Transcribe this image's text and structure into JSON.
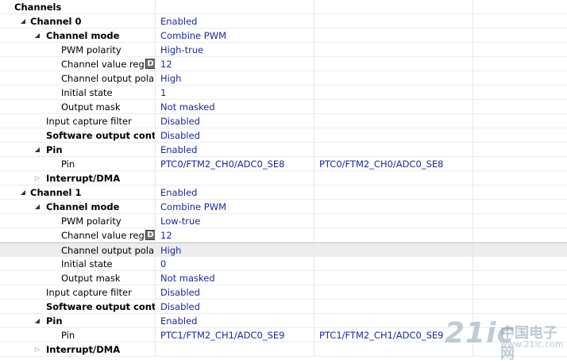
{
  "rows": [
    {
      "label": "Channels",
      "value": "",
      "value2": "",
      "depth": 0,
      "bold": true,
      "tri": "none"
    },
    {
      "label": "Channel 0",
      "value": "Enabled",
      "value2": "",
      "depth": 1,
      "bold": true,
      "tri": "expanded"
    },
    {
      "label": "Channel mode",
      "value": "Combine PWM",
      "value2": "",
      "depth": 2,
      "bold": true,
      "tri": "expanded"
    },
    {
      "label": "PWM polarity",
      "value": "High-true",
      "value2": "",
      "depth": 3,
      "bold": false,
      "tri": "none"
    },
    {
      "label": "Channel value register",
      "value": "12",
      "value2": "",
      "depth": 3,
      "bold": false,
      "tri": "none",
      "badge": "D"
    },
    {
      "label": "Channel output polarit",
      "value": "High",
      "value2": "",
      "depth": 3,
      "bold": false,
      "tri": "none"
    },
    {
      "label": "Initial state",
      "value": "1",
      "value2": "",
      "depth": 3,
      "bold": false,
      "tri": "none"
    },
    {
      "label": "Output mask",
      "value": "Not masked",
      "value2": "",
      "depth": 3,
      "bold": false,
      "tri": "none"
    },
    {
      "label": "Input capture filter",
      "value": "Disabled",
      "value2": "",
      "depth": 2,
      "bold": false,
      "tri": "none"
    },
    {
      "label": "Software output control",
      "value": "Disabled",
      "value2": "",
      "depth": 2,
      "bold": true,
      "tri": "none"
    },
    {
      "label": "Pin",
      "value": "Enabled",
      "value2": "",
      "depth": 2,
      "bold": true,
      "tri": "expanded"
    },
    {
      "label": "Pin",
      "value": "PTC0/FTM2_CH0/ADC0_SE8",
      "value2": "PTC0/FTM2_CH0/ADC0_SE8",
      "depth": 3,
      "bold": false,
      "tri": "none"
    },
    {
      "label": "Interrupt/DMA",
      "value": "",
      "value2": "",
      "depth": 2,
      "bold": true,
      "tri": "collapsed"
    },
    {
      "label": "Channel 1",
      "value": "Enabled",
      "value2": "",
      "depth": 1,
      "bold": true,
      "tri": "expanded"
    },
    {
      "label": "Channel mode",
      "value": "Combine PWM",
      "value2": "",
      "depth": 2,
      "bold": true,
      "tri": "expanded"
    },
    {
      "label": "PWM polarity",
      "value": "Low-true",
      "value2": "",
      "depth": 3,
      "bold": false,
      "tri": "none"
    },
    {
      "label": "Channel value register",
      "value": "12",
      "value2": "",
      "depth": 3,
      "bold": false,
      "tri": "none",
      "badge": "D"
    },
    {
      "label": "Channel output polarit",
      "value": "High",
      "value2": "",
      "depth": 3,
      "bold": false,
      "tri": "none",
      "selected": true
    },
    {
      "label": "Initial state",
      "value": "0",
      "value2": "",
      "depth": 3,
      "bold": false,
      "tri": "none"
    },
    {
      "label": "Output mask",
      "value": "Not masked",
      "value2": "",
      "depth": 3,
      "bold": false,
      "tri": "none"
    },
    {
      "label": "Input capture filter",
      "value": "Disabled",
      "value2": "",
      "depth": 2,
      "bold": false,
      "tri": "none"
    },
    {
      "label": "Software output control",
      "value": "Disabled",
      "value2": "",
      "depth": 2,
      "bold": true,
      "tri": "none"
    },
    {
      "label": "Pin",
      "value": "Enabled",
      "value2": "",
      "depth": 2,
      "bold": true,
      "tri": "expanded"
    },
    {
      "label": "Pin",
      "value": "PTC1/FTM2_CH1/ADC0_SE9",
      "value2": "PTC1/FTM2_CH1/ADC0_SE9",
      "depth": 3,
      "bold": false,
      "tri": "none"
    },
    {
      "label": "Interrupt/DMA",
      "value": "",
      "value2": "",
      "depth": 2,
      "bold": true,
      "tri": "collapsed"
    }
  ],
  "icons": {
    "expanded": "triangle-expanded-icon",
    "collapsed": "triangle-collapsed-icon"
  },
  "colors": {
    "value_text": "#1a2a9a",
    "selected_row": "#ededed"
  },
  "watermark": {
    "big": "21ic",
    "small": "中国电子网",
    "url": "www.21ic.com"
  }
}
